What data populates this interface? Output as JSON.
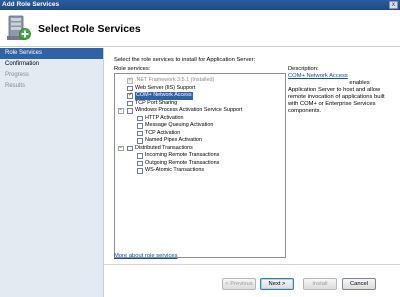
{
  "window": {
    "title": "Add Role Services",
    "close_glyph": "x"
  },
  "header": {
    "page_title": "Select Role Services",
    "icon": "server-add-role-icon"
  },
  "sidebar": {
    "items": [
      {
        "label": "Role Services",
        "state": "active"
      },
      {
        "label": "Confirmation",
        "state": "normal"
      },
      {
        "label": "Progress",
        "state": "disabled"
      },
      {
        "label": "Results",
        "state": "disabled"
      }
    ]
  },
  "main": {
    "instruction": "Select the role services to install for Application Server:",
    "services_label": "Role services:",
    "description_label": "Description:",
    "tree": [
      {
        "label": ".NET Framework 3.5.1  (Installed)",
        "checked": true,
        "disabled": true,
        "expander": "",
        "selected": false
      },
      {
        "label": "Web Server (IIS) Support",
        "checked": false,
        "disabled": false,
        "expander": "",
        "selected": false
      },
      {
        "label": "COM+ Network Access",
        "checked": true,
        "disabled": false,
        "expander": "",
        "selected": true
      },
      {
        "label": "TCP Port Sharing",
        "checked": false,
        "disabled": false,
        "expander": "",
        "selected": false
      },
      {
        "label": "Windows Process Activation Service Support",
        "checked": false,
        "disabled": false,
        "expander": "−",
        "selected": false
      },
      {
        "label": "HTTP Activation",
        "checked": false,
        "disabled": false,
        "expander": "",
        "selected": false
      },
      {
        "label": "Message Queuing Activation",
        "checked": false,
        "disabled": false,
        "expander": "",
        "selected": false
      },
      {
        "label": "TCP Activation",
        "checked": false,
        "disabled": false,
        "expander": "",
        "selected": false
      },
      {
        "label": "Named Pipes Activation",
        "checked": false,
        "disabled": false,
        "expander": "",
        "selected": false
      },
      {
        "label": "Distributed Transactions",
        "checked": false,
        "disabled": false,
        "expander": "−",
        "selected": false
      },
      {
        "label": "Incoming Remote Transactions",
        "checked": false,
        "disabled": false,
        "expander": "",
        "selected": false
      },
      {
        "label": "Outgoing Remote Transactions",
        "checked": false,
        "disabled": false,
        "expander": "",
        "selected": false
      },
      {
        "label": "WS-Atomic Transactions",
        "checked": false,
        "disabled": false,
        "expander": "",
        "selected": false
      }
    ],
    "description_link": "COM+ Network Access",
    "description_text": " enables Application Server to host and allow remote invocation of applications built with COM+ or Enterprise Services components.",
    "more_link": "More about role services"
  },
  "buttons": {
    "previous": "< Previous",
    "next": "Next >",
    "install": "Install",
    "cancel": "Cancel"
  }
}
